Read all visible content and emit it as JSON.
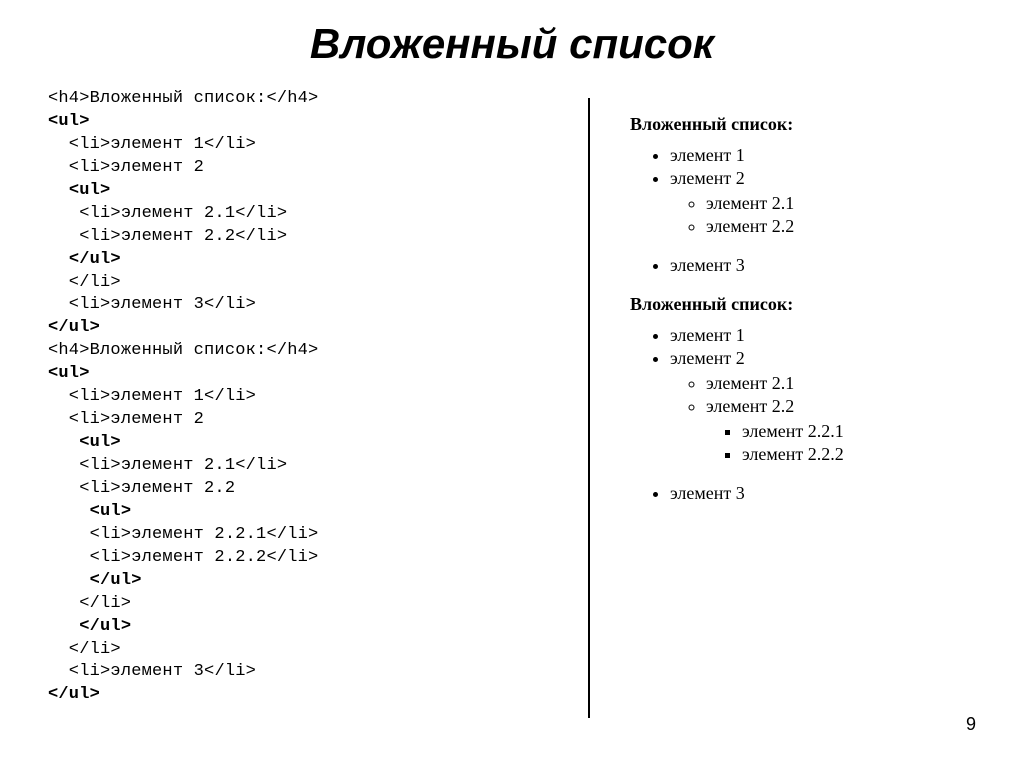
{
  "title": "Вложенный список",
  "page_number": "9",
  "code": {
    "h1": "Вложенный список:",
    "h2": "Вложенный список:",
    "li": {
      "e1": "элемент 1",
      "e2": "элемент 2",
      "e21": "элемент 2.1",
      "e22": "элемент 2.2",
      "e221": "элемент 2.2.1",
      "e222": "элемент 2.2.2",
      "e3": "элемент 3"
    }
  },
  "render": {
    "h1": "Вложенный список:",
    "h2": "Вложенный список:",
    "list1": {
      "i1": "элемент 1",
      "i2": "элемент 2",
      "i21": "элемент 2.1",
      "i22": "элемент 2.2",
      "i3": "элемент 3"
    },
    "list2": {
      "i1": "элемент 1",
      "i2": "элемент 2",
      "i21": "элемент 2.1",
      "i22": "элемент 2.2",
      "i221": "элемент 2.2.1",
      "i222": "элемент 2.2.2",
      "i3": "элемент 3"
    }
  }
}
